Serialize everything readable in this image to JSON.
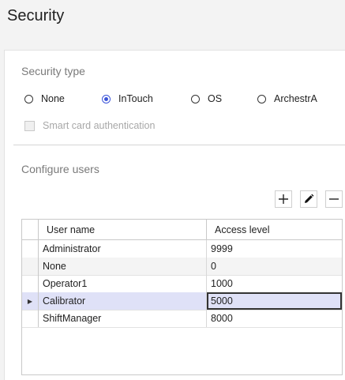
{
  "page": {
    "title": "Security"
  },
  "security_type": {
    "heading": "Security type",
    "options": [
      {
        "label": "None",
        "selected": false
      },
      {
        "label": "InTouch",
        "selected": true
      },
      {
        "label": "OS",
        "selected": false
      },
      {
        "label": "ArchestrA",
        "selected": false
      }
    ],
    "smart_card": {
      "label": "Smart card authentication",
      "checked": false,
      "enabled": false
    }
  },
  "configure_users": {
    "heading": "Configure users",
    "toolbar": {
      "add_icon": "plus-icon",
      "edit_icon": "pencil-icon",
      "remove_icon": "minus-icon"
    },
    "columns": [
      "User name",
      "Access level"
    ],
    "rows": [
      {
        "user": "Administrator",
        "level": "9999"
      },
      {
        "user": "None",
        "level": "0"
      },
      {
        "user": "Operator1",
        "level": "1000"
      },
      {
        "user": "Calibrator",
        "level": "5000"
      },
      {
        "user": "ShiftManager",
        "level": "8000"
      }
    ],
    "selected_row": 3,
    "accent_color": "#3b54d9"
  }
}
